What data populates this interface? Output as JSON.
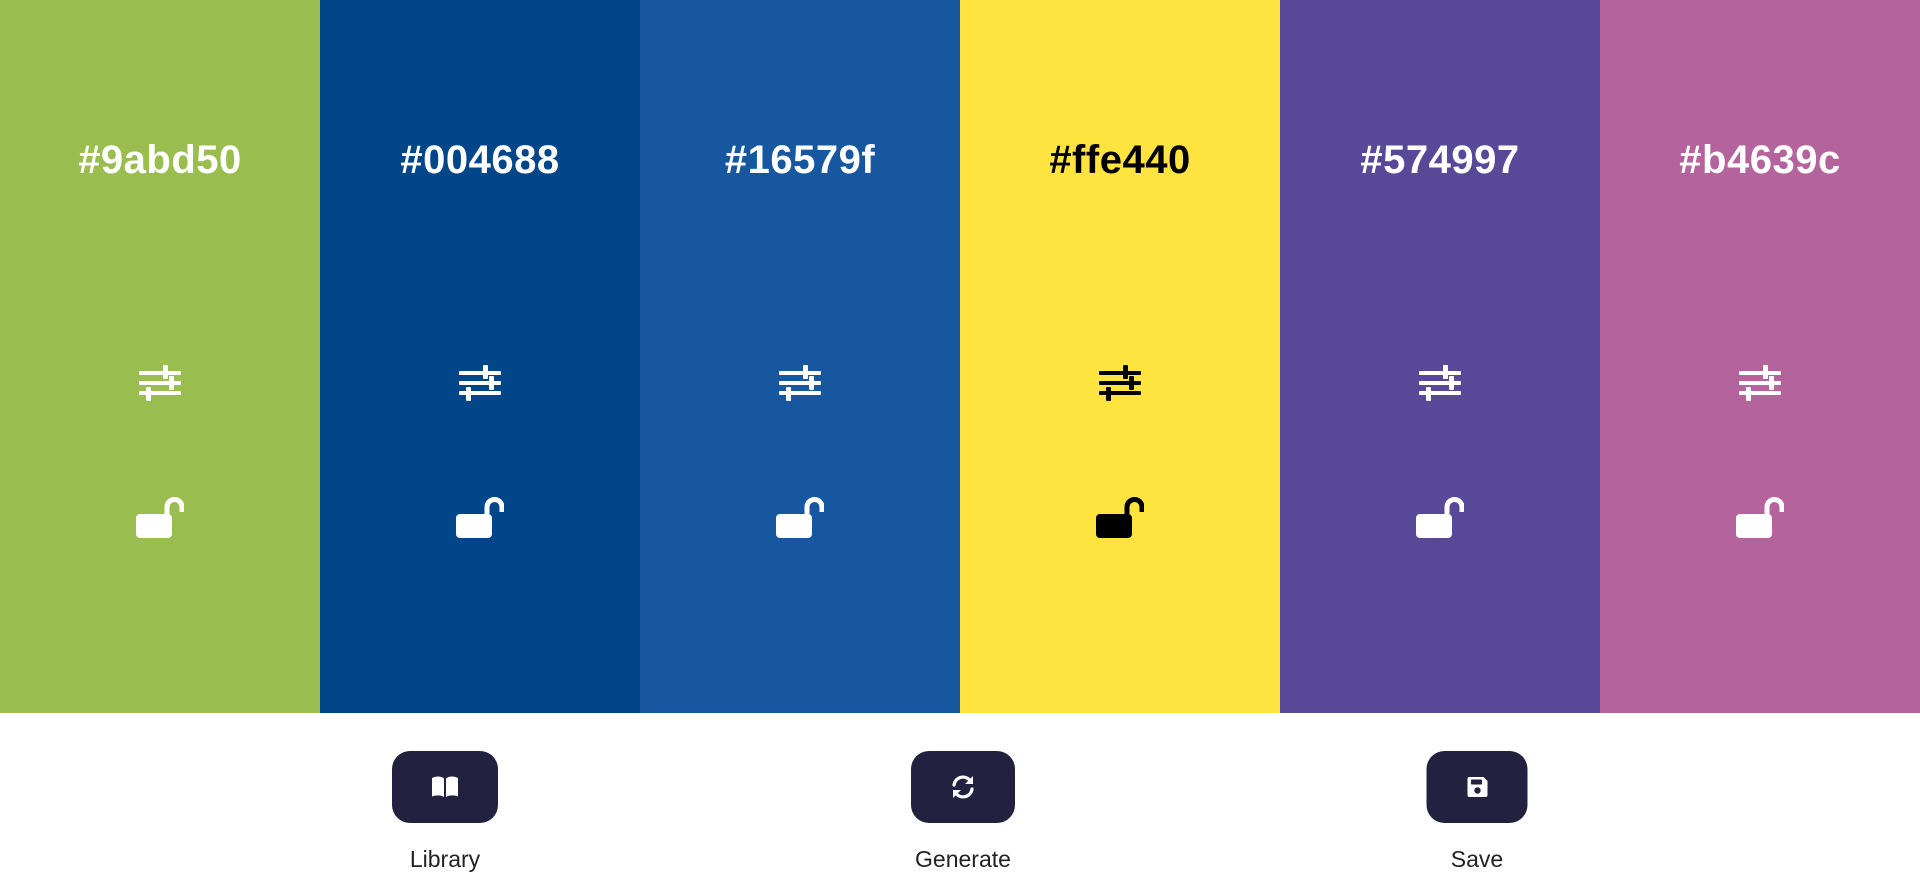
{
  "swatches": [
    {
      "hex": "#9abd50",
      "color": "#9abd50",
      "text_color": "#ffffff",
      "adjust_icon": "sliders-icon",
      "lock_icon": "unlock-icon"
    },
    {
      "hex": "#004688",
      "color": "#004688",
      "text_color": "#ffffff",
      "adjust_icon": "sliders-icon",
      "lock_icon": "unlock-icon"
    },
    {
      "hex": "#16579f",
      "color": "#16579f",
      "text_color": "#ffffff",
      "adjust_icon": "sliders-icon",
      "lock_icon": "unlock-icon"
    },
    {
      "hex": "#ffe440",
      "color": "#ffe440",
      "text_color": "#000000",
      "adjust_icon": "sliders-icon",
      "lock_icon": "unlock-icon"
    },
    {
      "hex": "#574997",
      "color": "#574997",
      "text_color": "#ffffff",
      "adjust_icon": "sliders-icon",
      "lock_icon": "unlock-icon"
    },
    {
      "hex": "#b4639c",
      "color": "#b4639c",
      "text_color": "#ffffff",
      "adjust_icon": "sliders-icon",
      "lock_icon": "unlock-icon"
    }
  ],
  "toolbar": {
    "button_color": "#222240",
    "library": {
      "label": "Library",
      "icon": "book-icon"
    },
    "generate": {
      "label": "Generate",
      "icon": "refresh-icon"
    },
    "save": {
      "label": "Save",
      "icon": "save-icon"
    }
  }
}
